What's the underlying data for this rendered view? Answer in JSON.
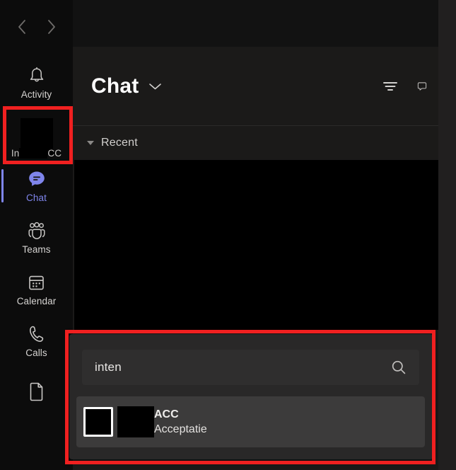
{
  "app": {
    "accent_color": "#7f85ec",
    "annotation_color": "#f02020"
  },
  "nav": {
    "back_label": "Back",
    "forward_label": "Forward",
    "back_icon": "chevron-left-icon",
    "forward_icon": "chevron-right-icon"
  },
  "sidebar": {
    "items": [
      {
        "label": "Activity",
        "icon": "bell-icon",
        "active": false
      },
      {
        "label_prefix": "In",
        "label_suffix": "CC",
        "icon": "redacted-org-icon",
        "redacted": true,
        "active": false
      },
      {
        "label": "Chat",
        "icon": "chat-bubble-icon",
        "active": true
      },
      {
        "label": "Teams",
        "icon": "teams-people-icon",
        "active": false
      },
      {
        "label": "Calendar",
        "icon": "calendar-icon",
        "active": false
      },
      {
        "label": "Calls",
        "icon": "phone-icon",
        "active": false
      },
      {
        "label": "",
        "icon": "file-document-icon",
        "active": false
      }
    ]
  },
  "pane": {
    "title": "Chat",
    "title_chevron_icon": "chevron-down-icon",
    "filter_icon": "filter-icon",
    "compose_icon": "new-chat-icon",
    "recent_label": "Recent",
    "recent_collapse_icon": "triangle-down-icon"
  },
  "search": {
    "value": "inten",
    "placeholder": "Search",
    "search_icon": "search-icon",
    "results": [
      {
        "title": "ACC",
        "subtitle": "Acceptatie",
        "avatar": "redacted-avatar"
      }
    ]
  }
}
